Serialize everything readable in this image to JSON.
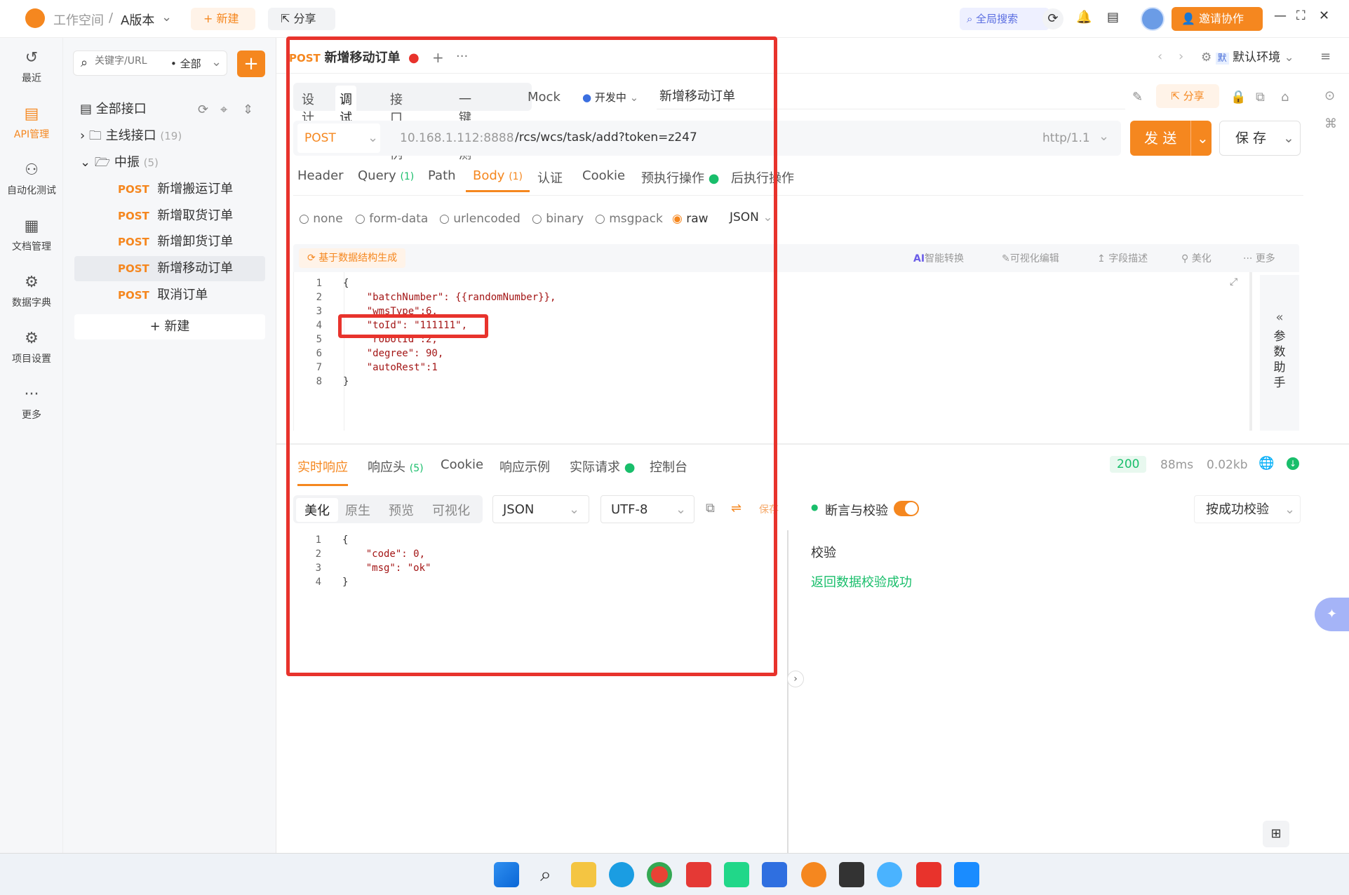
{
  "titlebar": {
    "workspace": "工作空间",
    "sep": "/",
    "version": "A版本",
    "new_label": "+ 新建",
    "share_label": "分享",
    "global_search": "全局搜索",
    "invite_label": "邀请协作"
  },
  "leftnav": [
    {
      "label": "最近",
      "icon": "↺"
    },
    {
      "label": "API管理",
      "icon": "▤"
    },
    {
      "label": "自动化测试",
      "icon": "⚇"
    },
    {
      "label": "文档管理",
      "icon": "▦"
    },
    {
      "label": "数据字典",
      "icon": "⚙"
    },
    {
      "label": "项目设置",
      "icon": "⚙"
    },
    {
      "label": "更多",
      "icon": "···"
    }
  ],
  "sidebar": {
    "search_placeholder": "关键字/URL",
    "filter": "全部",
    "all_apis": "全部接口",
    "folders": [
      {
        "name": "主线接口",
        "count": "(19)"
      },
      {
        "name": "中振",
        "count": "(5)"
      }
    ],
    "items": [
      {
        "method": "POST",
        "name": "新增搬运订单"
      },
      {
        "method": "POST",
        "name": "新增取货订单"
      },
      {
        "method": "POST",
        "name": "新增卸货订单"
      },
      {
        "method": "POST",
        "name": "新增移动订单"
      },
      {
        "method": "POST",
        "name": "取消订单"
      }
    ],
    "new_label": "+ 新建"
  },
  "tab": {
    "method": "POST",
    "name": "新增移动订单"
  },
  "env": "默认环境",
  "subtabs": [
    "设计",
    "调试",
    "接口用例",
    "一键压测",
    "Mock"
  ],
  "status": "开发中",
  "api_name": "新增移动订单",
  "share_label": "分享",
  "request": {
    "method": "POST",
    "host": "10.168.1.112:8888",
    "path": "/rcs/wcs/task/add?token=z247",
    "protocol": "http/1.1",
    "send": "发 送",
    "save": "保 存"
  },
  "param_tabs": [
    {
      "label": "Header",
      "badge": ""
    },
    {
      "label": "Query",
      "badge": "(1)"
    },
    {
      "label": "Path",
      "badge": ""
    },
    {
      "label": "Body",
      "badge": "(1)"
    },
    {
      "label": "认证",
      "badge": ""
    },
    {
      "label": "Cookie",
      "badge": ""
    },
    {
      "label": "预执行操作",
      "badge": ""
    },
    {
      "label": "后执行操作",
      "badge": ""
    }
  ],
  "body_types": [
    "none",
    "form-data",
    "urlencoded",
    "binary",
    "msgpack",
    "raw"
  ],
  "body_format": "JSON",
  "body_tools": {
    "generate": "基于数据结构生成",
    "ai": "智能转换",
    "visual": "可视化编辑",
    "desc": "字段描述",
    "beautify": "美化",
    "more": "更多"
  },
  "body_lines": [
    "{",
    "    \"batchNumber\": {{randomNumber}},",
    "    \"wmsType\":6,",
    "    \"toId\": \"111111\",",
    "    \"robotId\":2,",
    "    \"degree\": 90,",
    "    \"autoRest\":1",
    "}"
  ],
  "helper": "参数助手",
  "resp_tabs": [
    {
      "label": "实时响应",
      "badge": ""
    },
    {
      "label": "响应头",
      "badge": "(5)"
    },
    {
      "label": "Cookie",
      "badge": ""
    },
    {
      "label": "响应示例",
      "badge": ""
    },
    {
      "label": "实际请求",
      "badge": ""
    },
    {
      "label": "控制台",
      "badge": ""
    }
  ],
  "resp_meta": {
    "code": "200",
    "time": "88ms",
    "size": "0.02kb"
  },
  "view_modes": [
    "美化",
    "原生",
    "预览",
    "可视化"
  ],
  "resp_format": "JSON",
  "resp_encoding": "UTF-8",
  "resp_save": "保存",
  "resp_lines": [
    "{",
    "    \"code\": 0,",
    "    \"msg\": \"ok\"",
    "}"
  ],
  "assert": {
    "title": "断言与校验",
    "mode": "按成功校验",
    "check": "校验",
    "result": "返回数据校验成功"
  }
}
